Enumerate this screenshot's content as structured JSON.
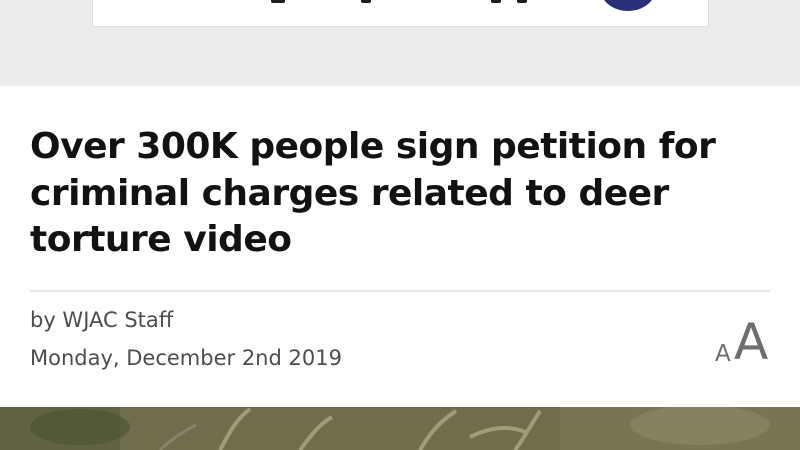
{
  "article": {
    "headline": "Over 300K people sign petition for criminal charges related to deer torture video",
    "byline": "by WJAC Staff",
    "date": "Monday, December 2nd 2019"
  },
  "font_size_control": {
    "small_glyph": "A",
    "large_glyph": "A"
  },
  "colors": {
    "page_background": "#ececec",
    "article_background": "#ffffff",
    "headline": "#121212",
    "meta_text": "#4d4d4d",
    "ad_circle": "#2a2f7a"
  }
}
